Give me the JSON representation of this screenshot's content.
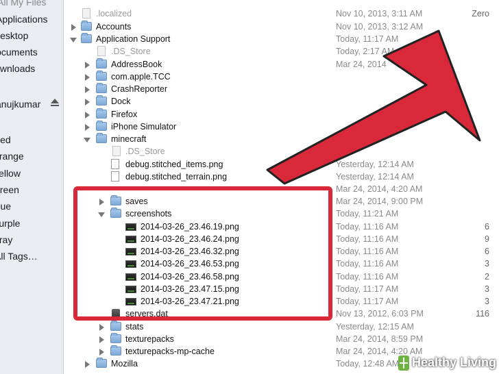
{
  "sidebar": {
    "items": [
      {
        "label": "All My Files"
      },
      {
        "label": "Applications"
      },
      {
        "label": "Desktop"
      },
      {
        "label": "Documents"
      },
      {
        "label": "Downloads"
      },
      {
        "label": "anujkumar"
      },
      {
        "label": "Red"
      },
      {
        "label": "Orange"
      },
      {
        "label": "Yellow"
      },
      {
        "label": "Green"
      },
      {
        "label": "Blue"
      },
      {
        "label": "Purple"
      },
      {
        "label": "Gray"
      },
      {
        "label": "All Tags…"
      }
    ]
  },
  "rows": [
    {
      "name": ".localized",
      "date": "Nov 10, 2013, 3:11 AM",
      "size": "Zero"
    },
    {
      "name": "Accounts",
      "date": "Nov 10, 2013, 3:12 AM",
      "size": ""
    },
    {
      "name": "Application Support",
      "date": "Today, 11:17 AM",
      "size": ""
    },
    {
      "name": ".DS_Store",
      "date": "Today, 2:17 AM",
      "size": ""
    },
    {
      "name": "AddressBook",
      "date": "Mar 24, 2014",
      "size": ""
    },
    {
      "name": "com.apple.TCC",
      "date": "",
      "size": ""
    },
    {
      "name": "CrashReporter",
      "date": "",
      "size": ""
    },
    {
      "name": "Dock",
      "date": "",
      "size": ""
    },
    {
      "name": "Firefox",
      "date": "",
      "size": ""
    },
    {
      "name": "iPhone Simulator",
      "date": "",
      "size": ""
    },
    {
      "name": "minecraft",
      "date": "",
      "size": ""
    },
    {
      "name": ".DS_Store",
      "date": "",
      "size": ""
    },
    {
      "name": "debug.stitched_items.png",
      "date": "Yesterday, 12:14 AM",
      "size": ""
    },
    {
      "name": "debug.stitched_terrain.png",
      "date": "Yesterday, 12:14 AM",
      "size": ""
    },
    {
      "name": "",
      "date": "Mar 24, 2014, 4:20 AM",
      "size": ""
    },
    {
      "name": "saves",
      "date": "Mar 24, 2014, 9:00 PM",
      "size": ""
    },
    {
      "name": "screenshots",
      "date": "Today, 11:21 AM",
      "size": ""
    },
    {
      "name": "2014-03-26_23.46.19.png",
      "date": "Today, 11:16 AM",
      "size": "6"
    },
    {
      "name": "2014-03-26_23.46.24.png",
      "date": "Today, 11:16 AM",
      "size": "9"
    },
    {
      "name": "2014-03-26_23.46.32.png",
      "date": "Today, 11:16 AM",
      "size": "6"
    },
    {
      "name": "2014-03-26_23.46.53.png",
      "date": "Today, 11:16 AM",
      "size": "3"
    },
    {
      "name": "2014-03-26_23.46.58.png",
      "date": "Today, 11:16 AM",
      "size": "2"
    },
    {
      "name": "2014-03-26_23.47.15.png",
      "date": "Today, 11:17 AM",
      "size": "3"
    },
    {
      "name": "2014-03-26_23.47.21.png",
      "date": "Today, 11:17 AM",
      "size": "3"
    },
    {
      "name": "servers.dat",
      "date": "Nov 13, 2012, 6:03 PM",
      "size": "116"
    },
    {
      "name": "stats",
      "date": "Yesterday, 12:15 AM",
      "size": ""
    },
    {
      "name": "texturepacks",
      "date": "Mar 24, 2014, 8:59 PM",
      "size": ""
    },
    {
      "name": "texturepacks-mp-cache",
      "date": "Mar 24, 2014, 4:20 AM",
      "size": ""
    },
    {
      "name": "Mozilla",
      "date": "Today, 12:48 AM",
      "size": ""
    }
  ],
  "annotation": {
    "color": "#d8283a"
  },
  "watermark": {
    "label": "Healthy Living"
  }
}
